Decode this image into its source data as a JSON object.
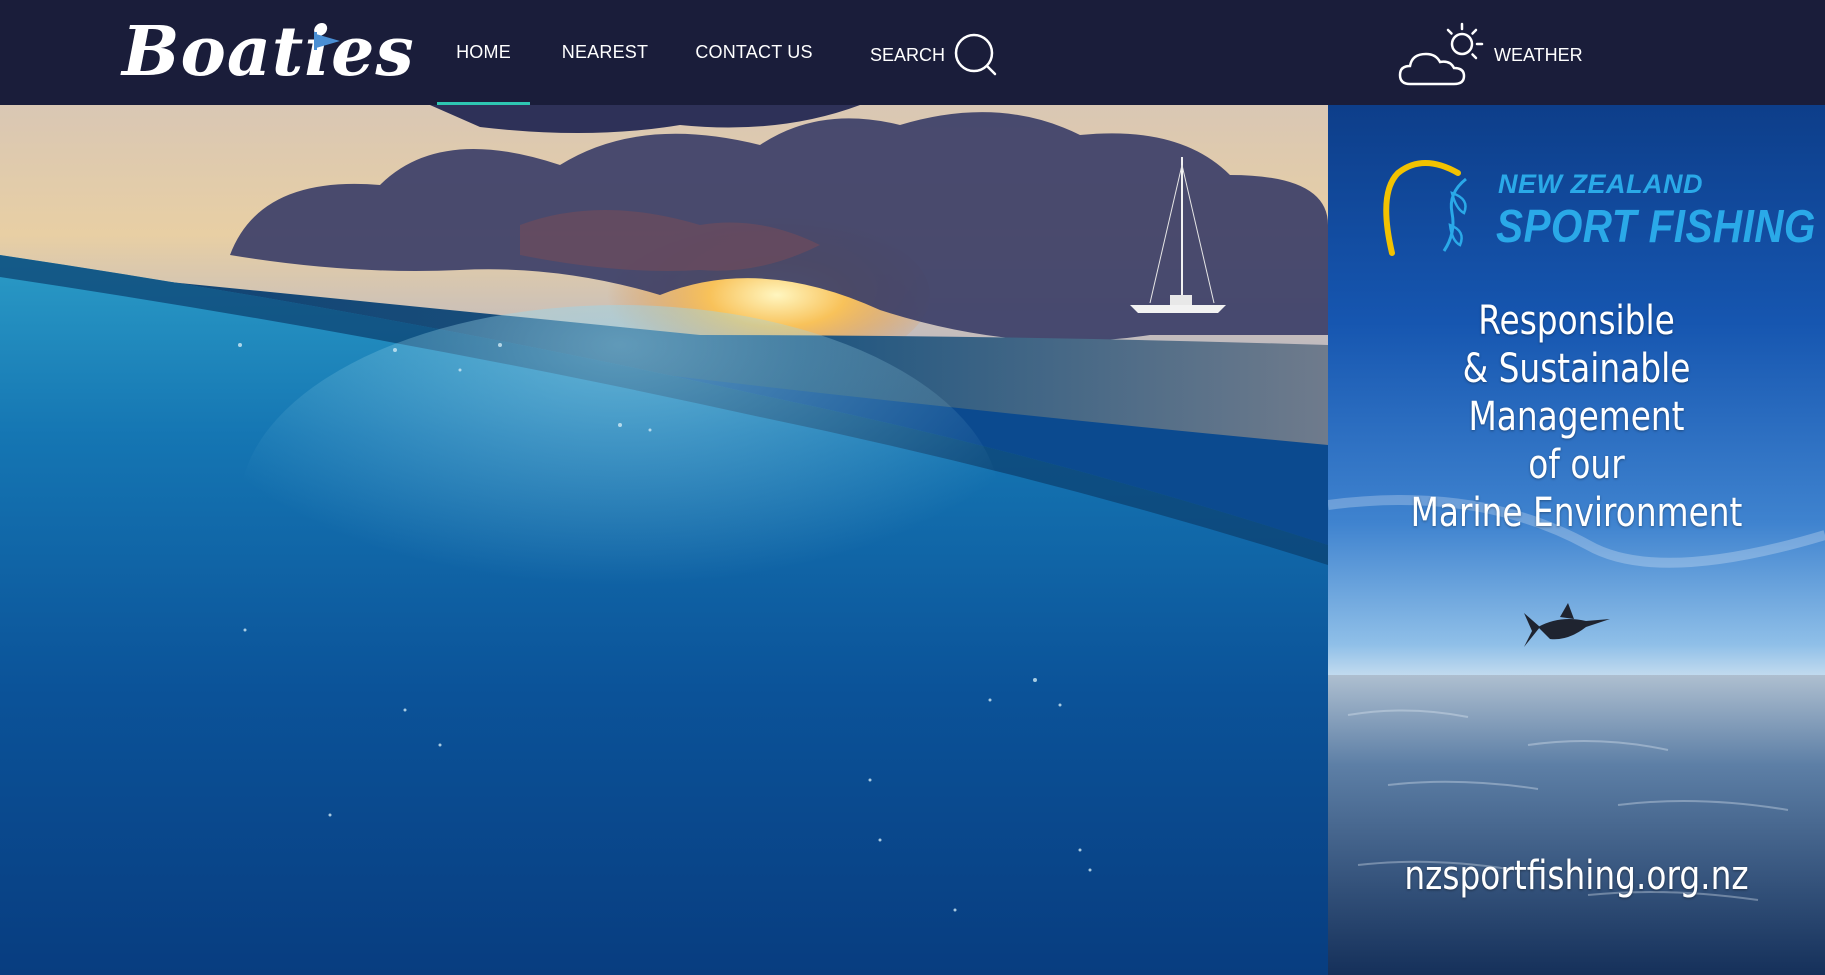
{
  "header": {
    "logo_text": "Boaties",
    "nav": [
      {
        "label": "HOME",
        "active": true
      },
      {
        "label": "NEAREST",
        "active": false
      },
      {
        "label": "CONTACT US",
        "active": false
      }
    ],
    "search_label": "SEARCH",
    "weather_label": "WEATHER"
  },
  "ad": {
    "brand_line1": "NEW ZEALAND",
    "brand_line2": "SPORT FISHING",
    "tagline": [
      "Responsible",
      "& Sustainable",
      "Management",
      "of our",
      "Marine Environment"
    ],
    "url": "nzsportfishing.org.nz"
  },
  "colors": {
    "header_bg": "#1a1d3a",
    "nav_active_underline": "#2ec6b2",
    "ad_brand": "#2aa9e8",
    "ad_logo_arc": "#f2c200"
  },
  "icons": {
    "search": "search-icon",
    "weather": "partly-cloudy-icon"
  }
}
